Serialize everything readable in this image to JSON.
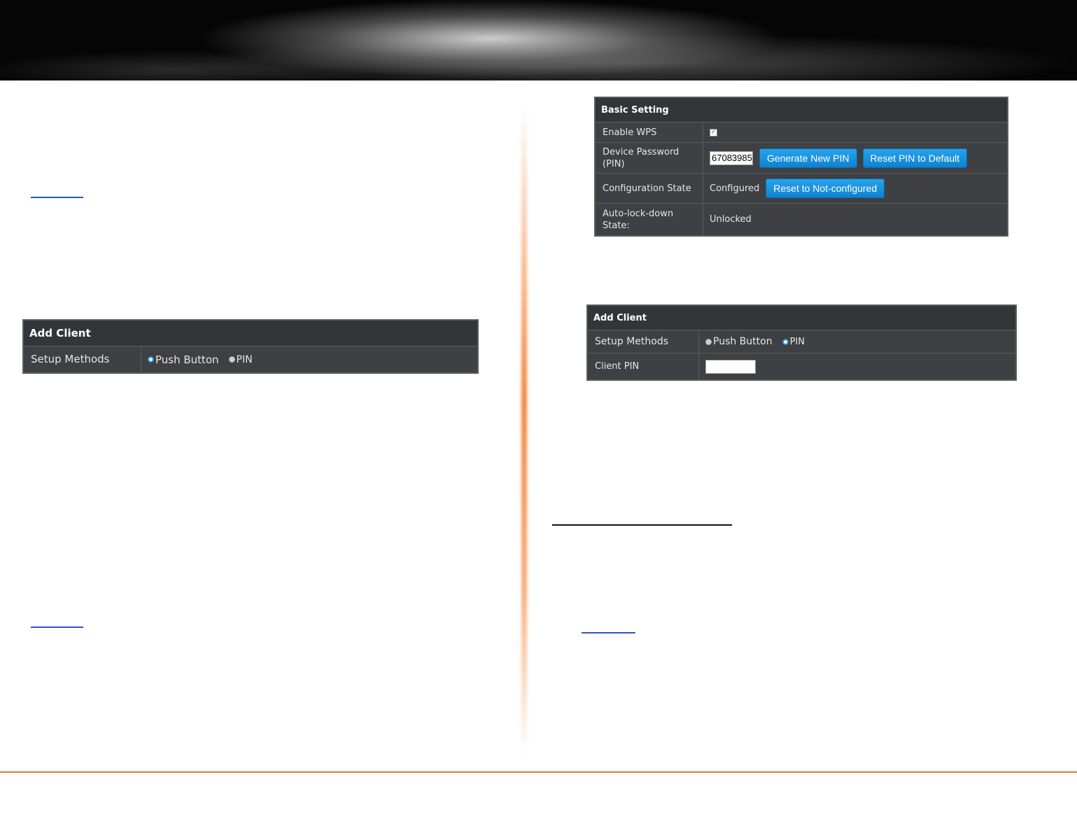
{
  "basic_setting": {
    "title": "Basic Setting",
    "enable_wps_label": "Enable WPS",
    "enable_wps_checked": true,
    "device_password_label": "Device Password (PIN)",
    "pin_value": "67083985",
    "generate_pin_button": "Generate New PIN",
    "reset_pin_button": "Reset PIN to Default",
    "config_state_label": "Configuration State",
    "config_state_value": "Configured",
    "reset_not_configured_button": "Reset to Not-configured",
    "auto_lock_label": "Auto-lock-down State:",
    "auto_lock_value": "Unlocked"
  },
  "add_client_left": {
    "title": "Add Client",
    "setup_methods_label": "Setup Methods",
    "option_push_button": "Push Button",
    "option_pin": "PIN",
    "selected": "Push Button"
  },
  "add_client_right": {
    "title": "Add Client",
    "setup_methods_label": "Setup Methods",
    "option_push_button": "Push Button",
    "option_pin": "PIN",
    "selected": "PIN",
    "client_pin_label": "Client PIN",
    "client_pin_value": ""
  },
  "colors": {
    "accent_orange": "#e8752a",
    "button_blue": "#1a8fd6",
    "panel_dark": "#2a2c2e"
  }
}
